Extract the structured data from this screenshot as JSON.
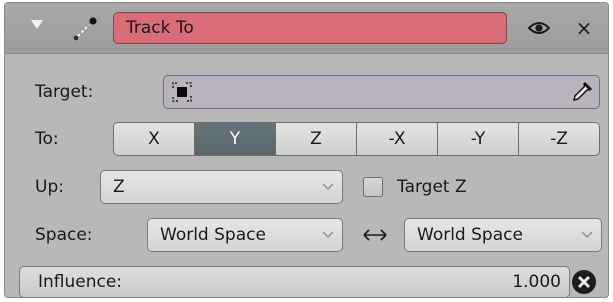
{
  "header": {
    "name": "Track To",
    "collapse_icon": "collapse-triangle-icon",
    "type_icon": "track-to-constraint-icon",
    "visibility_icon": "eye-icon",
    "close_icon": "close-icon",
    "close_glyph": "×",
    "name_field_color": "#dc6b78"
  },
  "target": {
    "label": "Target:",
    "value": "",
    "object_icon": "object-icon",
    "picker_icon": "eyedropper-icon"
  },
  "to_axis": {
    "label": "To:",
    "options": [
      "X",
      "Y",
      "Z",
      "-X",
      "-Y",
      "-Z"
    ],
    "selected": "Y",
    "active_color": "#5f6d72"
  },
  "up_axis": {
    "label": "Up:",
    "value": "Z"
  },
  "target_z": {
    "label": "Target Z",
    "checked": false
  },
  "space": {
    "label": "Space:",
    "owner_space": "World Space",
    "target_space": "World Space",
    "swap_icon": "left-right-arrow-icon"
  },
  "influence": {
    "label": "Influence:",
    "value": "1.000",
    "reset_icon": "reset-x-icon"
  }
}
